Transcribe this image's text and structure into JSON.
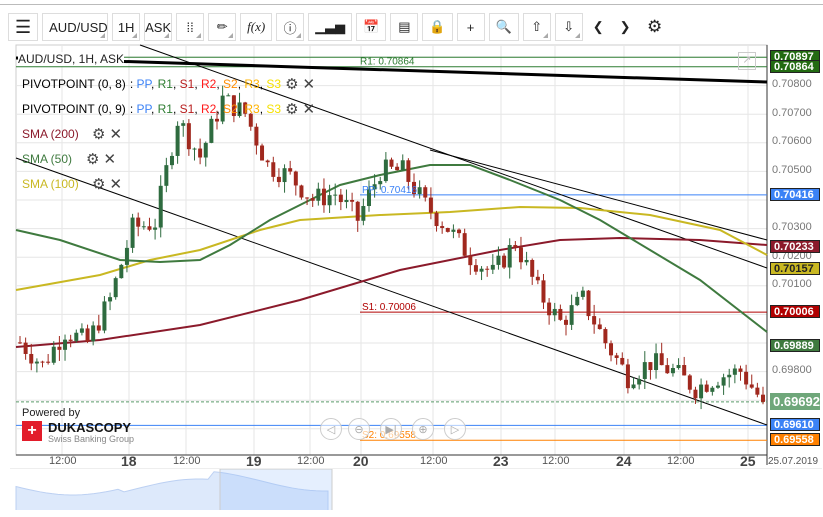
{
  "toolbar": {
    "instrument": "AUD/USD",
    "period": "1H",
    "side": "ASK",
    "fx": "f(x)"
  },
  "legend": {
    "title": "AUD/USD, 1H, ASK",
    "pivot1": "PIVOTPOINT (0, 8)",
    "pivot2": "PIVOTPOINT (0, 9)",
    "pivot_parts": [
      {
        "t": "PP",
        "c": "#3b82f6"
      },
      {
        "t": "R1",
        "c": "#2e7d32"
      },
      {
        "t": "S1",
        "c": "#b71c1c"
      },
      {
        "t": "R2",
        "c": "#ff1a1a"
      },
      {
        "t": "S2",
        "c": "#ff8c00"
      },
      {
        "t": "R3",
        "c": "#ffb300"
      },
      {
        "t": "S3",
        "c": "#f5e000"
      }
    ],
    "sma200": "SMA (200)",
    "sma50": "SMA (50)",
    "sma100": "SMA (100)"
  },
  "price_axis": {
    "ticks": [
      "0.70800",
      "0.70700",
      "0.70600",
      "0.70500",
      "0.70300",
      "0.70200",
      "0.70100",
      "0.69800"
    ],
    "tick_values": [
      0.708,
      0.707,
      0.706,
      0.705,
      0.703,
      0.702,
      0.701,
      0.698
    ]
  },
  "price_labels": [
    {
      "text": "0.70897",
      "value": 0.70897,
      "color": "#236b12"
    },
    {
      "text": "0.70864",
      "value": 0.70864,
      "color": "#236b12"
    },
    {
      "text": "0.70416",
      "value": 0.70416,
      "color": "#3b82f6"
    },
    {
      "text": "0.70233",
      "value": 0.70233,
      "color": "#8b1a2b"
    },
    {
      "text": "0.70157",
      "value": 0.70157,
      "color": "#c9b822",
      "dark": true
    },
    {
      "text": "0.70006",
      "value": 0.70006,
      "color": "#b00000"
    },
    {
      "text": "0.69889",
      "value": 0.69889,
      "color": "#3f7a3f"
    },
    {
      "text": "0.69692",
      "value": 0.69692,
      "color": "#6fa77a"
    },
    {
      "text": "0.69610",
      "value": 0.6961,
      "color": "#3b82f6"
    },
    {
      "text": "0.69558",
      "value": 0.69558,
      "color": "#ff8000"
    }
  ],
  "line_labels": {
    "r1": "R1: 0.70864",
    "pp": "PP: 0.70416",
    "s1": "S1: 0.70006",
    "s2": "S2: 0.69558"
  },
  "time_axis": [
    {
      "t": "12:00"
    },
    {
      "t": "18",
      "d": true
    },
    {
      "t": "12:00"
    },
    {
      "t": "19",
      "d": true
    },
    {
      "t": "12:00"
    },
    {
      "t": "20",
      "d": true
    },
    {
      "t": "12:00"
    },
    {
      "t": "23",
      "d": true
    },
    {
      "t": "12:00"
    },
    {
      "t": "24",
      "d": true
    },
    {
      "t": "12:00"
    },
    {
      "t": "25",
      "d": true
    }
  ],
  "date": "25.07.2019",
  "branding": {
    "powered": "Powered by",
    "name": "DUKASCOPY",
    "sub": "Swiss Banking Group"
  },
  "chart_data": {
    "type": "candlestick",
    "closes": [
      0.699,
      0.6982,
      0.6994,
      0.699,
      0.7005,
      0.703,
      0.7032,
      0.7068,
      0.7055,
      0.7075,
      0.707,
      0.7052,
      0.7048,
      0.704,
      0.7042,
      0.7033,
      0.705,
      0.705,
      0.7038,
      0.703,
      0.702,
      0.7014,
      0.7025,
      0.7008,
      0.6997,
      0.7005,
      0.699,
      0.6978,
      0.6983,
      0.698,
      0.6974,
      0.6978,
      0.698,
      0.6969
    ],
    "current": 0.69692
  }
}
